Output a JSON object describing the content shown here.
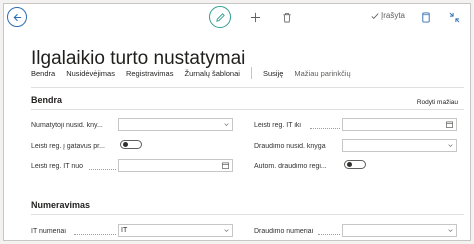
{
  "toolbar": {
    "back_icon": "arrow-left-icon",
    "edit_icon": "pencil-icon",
    "add_icon": "plus-icon",
    "delete_icon": "trash-icon",
    "saved_icon": "check-icon",
    "saved_label": "Įrašyta",
    "open_new_icon": "open-in-new-window-icon",
    "collapse_icon": "collapse-icon",
    "accent_color": "#2f9e8f"
  },
  "page": {
    "title": "Ilgalaikio turto nustatymai"
  },
  "actions": {
    "items": [
      "Bendra",
      "Nusidėvėjimas",
      "Registravimas",
      "Žurnalų šablonai",
      "Susiję",
      "Mažiau parinkčių"
    ]
  },
  "general": {
    "title": "Bendra",
    "show_less": "Rodyti mažiau",
    "fields": {
      "default_depr_book": {
        "label": "Numatytoji nusid. kny...",
        "value": ""
      },
      "acq_asset": {
        "label": "Leisti reg. į gatavus pr...",
        "toggle": false
      },
      "allow_posting_from": {
        "label": "Leisti reg. IT nuo",
        "value": ""
      },
      "allow_posting_to": {
        "label": "Leisti reg. IT iki",
        "value": ""
      },
      "insurance_depr_book": {
        "label": "Draudimo nusid. knyga",
        "value": ""
      },
      "auto_insurance": {
        "label": "Autom. draudimo regi...",
        "toggle": false
      }
    }
  },
  "numbering": {
    "title": "Numeravimas",
    "fields": {
      "fa_nos": {
        "label": "IT numeriai",
        "value": "IT"
      },
      "insurance_nos": {
        "label": "Draudimo numeriai",
        "value": ""
      }
    }
  }
}
